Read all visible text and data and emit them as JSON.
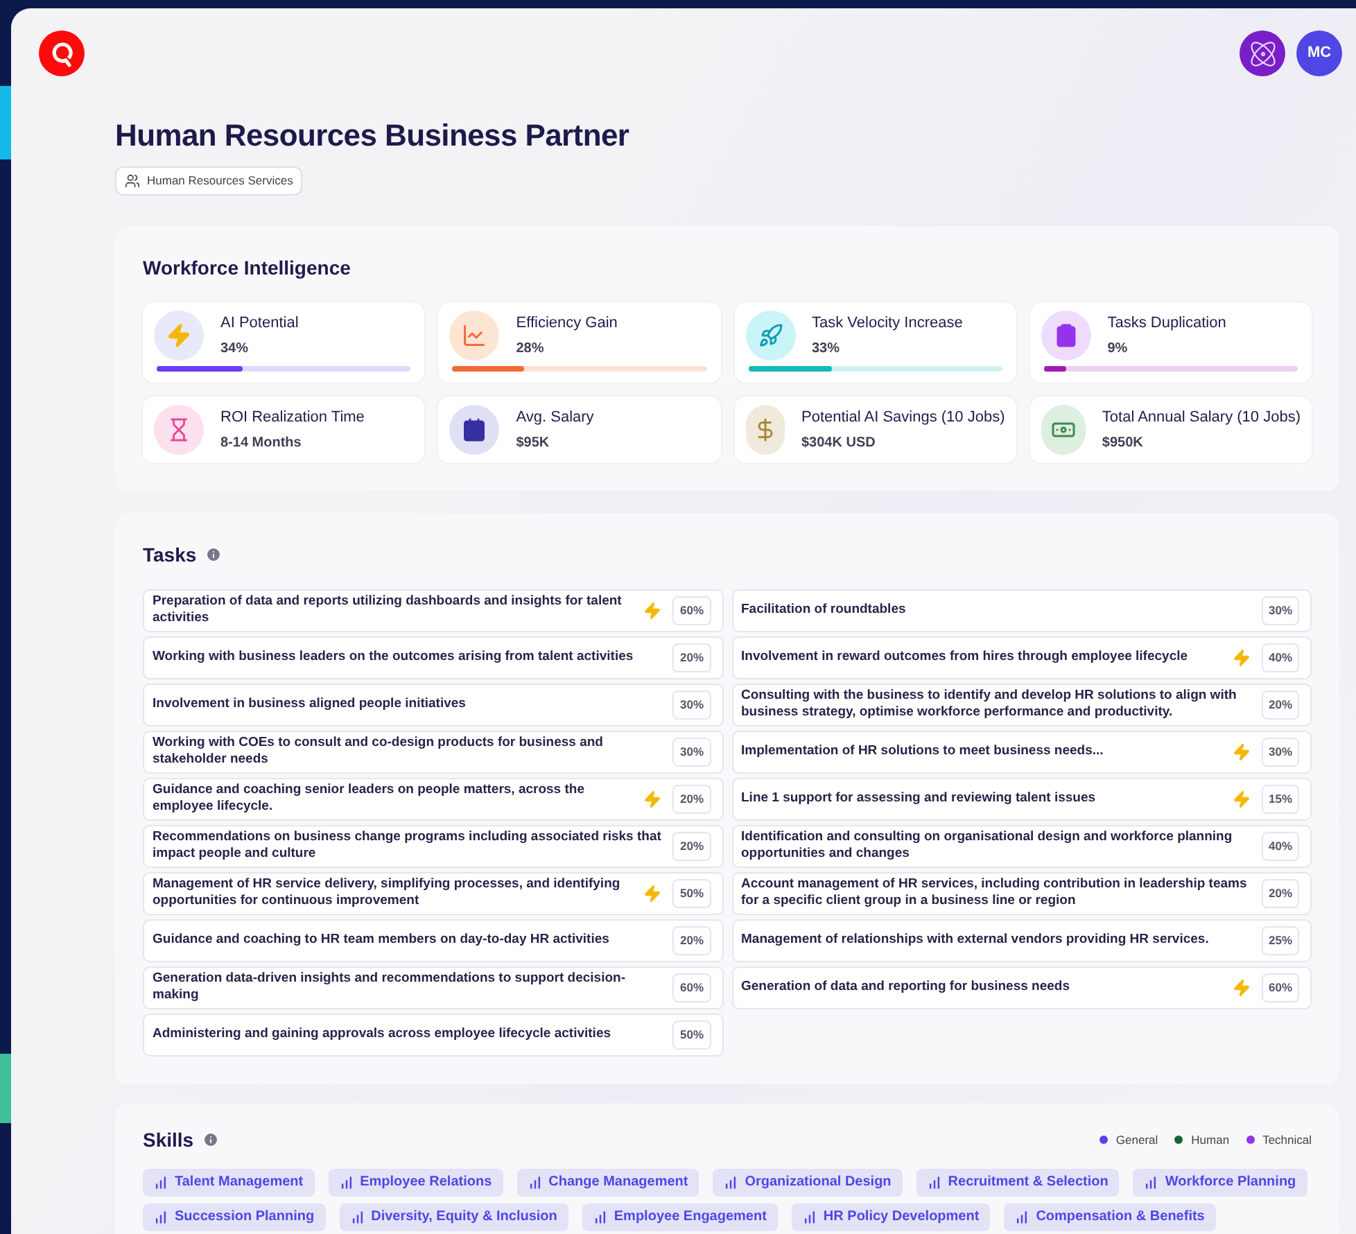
{
  "header": {
    "avatar_initials": "MC"
  },
  "title": "Human Resources Business Partner",
  "department_tag": "Human Resources Services",
  "workforce_intelligence": {
    "title": "Workforce Intelligence",
    "metrics": [
      {
        "label": "AI Potential",
        "value": "34%",
        "level": 0.34,
        "color": "#6d3cf5"
      },
      {
        "label": "Efficiency Gain",
        "value": "28%",
        "level": 0.28,
        "color": "#f26b3a"
      },
      {
        "label": "Task Velocity Increase",
        "value": "33%",
        "level": 0.33,
        "color": "#14b8b8"
      },
      {
        "label": "Tasks Duplication",
        "value": "9%",
        "level": 0.09,
        "color": "#a21caf"
      },
      {
        "label": "ROI Realization Time",
        "value": "8-14 Months"
      },
      {
        "label": "Avg. Salary",
        "value": "$95K"
      },
      {
        "label": "Potential AI Savings (10 Jobs)",
        "value": "$304K USD"
      },
      {
        "label": "Total Annual Salary (10 Jobs)",
        "value": "$950K"
      }
    ]
  },
  "tasks": {
    "title": "Tasks",
    "left": [
      {
        "text": "Preparation of data and reports utilizing dashboards and insights for talent activities",
        "ai": true,
        "percent": "60%"
      },
      {
        "text": "Working with business leaders on the outcomes arising from talent activities",
        "ai": false,
        "percent": "20%"
      },
      {
        "text": "Involvement in business aligned people initiatives",
        "ai": false,
        "percent": "30%"
      },
      {
        "text": "Working with COEs to consult and co-design products for business and stakeholder needs",
        "ai": false,
        "percent": "30%"
      },
      {
        "text": "Guidance and coaching senior leaders on people matters, across the employee lifecycle.",
        "ai": true,
        "percent": "20%"
      },
      {
        "text": "Recommendations on business change programs including associated risks that impact people and culture",
        "ai": false,
        "percent": "20%"
      },
      {
        "text": "Management of HR service delivery, simplifying processes, and identifying opportunities for continuous improvement",
        "ai": true,
        "percent": "50%"
      },
      {
        "text": "Guidance and coaching to HR team members on day-to-day HR activities",
        "ai": false,
        "percent": "20%"
      },
      {
        "text": "Generation data-driven insights and recommendations to support decision-making",
        "ai": false,
        "percent": "60%"
      },
      {
        "text": "Administering and gaining approvals across employee lifecycle activities",
        "ai": false,
        "percent": "50%"
      }
    ],
    "right": [
      {
        "text": "Facilitation of roundtables",
        "ai": false,
        "percent": "30%"
      },
      {
        "text": "Involvement in reward outcomes from hires through employee lifecycle",
        "ai": true,
        "percent": "40%"
      },
      {
        "text": "Consulting with the business to identify and develop HR solutions to align with business strategy, optimise workforce performance and productivity.",
        "ai": false,
        "percent": "20%"
      },
      {
        "text": "Implementation of HR solutions to meet business needs...",
        "ai": true,
        "percent": "30%"
      },
      {
        "text": "Line 1 support for assessing and reviewing talent issues",
        "ai": true,
        "percent": "15%"
      },
      {
        "text": "Identification and consulting on organisational design and workforce planning opportunities and changes",
        "ai": false,
        "percent": "40%"
      },
      {
        "text": "Account management of HR services, including contribution in leadership teams for a specific client group in a business line or region",
        "ai": false,
        "percent": "20%"
      },
      {
        "text": "Management of relationships with external vendors providing HR services.",
        "ai": false,
        "percent": "25%"
      },
      {
        "text": "Generation of data and reporting for business needs",
        "ai": true,
        "percent": "60%"
      }
    ]
  },
  "skills": {
    "title": "Skills",
    "legend": [
      {
        "label": "General",
        "color": "#4f46e5"
      },
      {
        "label": "Human",
        "color": "#166534"
      },
      {
        "label": "Technical",
        "color": "#9333ea"
      }
    ],
    "items": [
      {
        "label": "Talent Management",
        "color": "#4f46e5"
      },
      {
        "label": "Employee Relations",
        "color": "#4f46e5"
      },
      {
        "label": "Change Management",
        "color": "#4f46e5"
      },
      {
        "label": "Organizational Design",
        "color": "#4f46e5"
      },
      {
        "label": "Recruitment & Selection",
        "color": "#4f46e5"
      },
      {
        "label": "Workforce Planning",
        "color": "#4f46e5"
      },
      {
        "label": "Succession Planning",
        "color": "#4f46e5"
      },
      {
        "label": "Diversity, Equity & Inclusion",
        "color": "#4f46e5"
      },
      {
        "label": "Employee Engagement",
        "color": "#4f46e5"
      },
      {
        "label": "HR Policy Development",
        "color": "#4f46e5"
      },
      {
        "label": "Compensation & Benefits",
        "color": "#4f46e5"
      }
    ]
  }
}
